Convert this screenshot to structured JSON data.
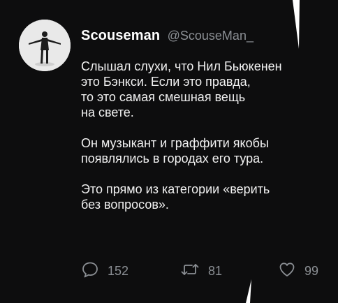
{
  "user": {
    "display_name": "Scouseman",
    "handle": "@ScouseMan_"
  },
  "tweet": {
    "paragraphs": [
      [
        "Слышал слухи, что Нил Бьюкенен",
        "это Бэнкси. Если это правда,",
        "то это самая смешная вещь",
        "на свете."
      ],
      [
        "Он музыкант и граффити якобы",
        "появлялись в городах его тура."
      ],
      [
        "Это прямо из категории «верить",
        "без вопросов»."
      ]
    ]
  },
  "actions": {
    "reply_count": "152",
    "retweet_count": "81",
    "like_count": "99"
  },
  "icons": {
    "reply": "speech-bubble-icon",
    "retweet": "retweet-arrows-icon",
    "like": "heart-icon"
  },
  "colors": {
    "background": "#0d0d0e",
    "text": "#f1f1f1",
    "muted": "#8b8f94"
  }
}
